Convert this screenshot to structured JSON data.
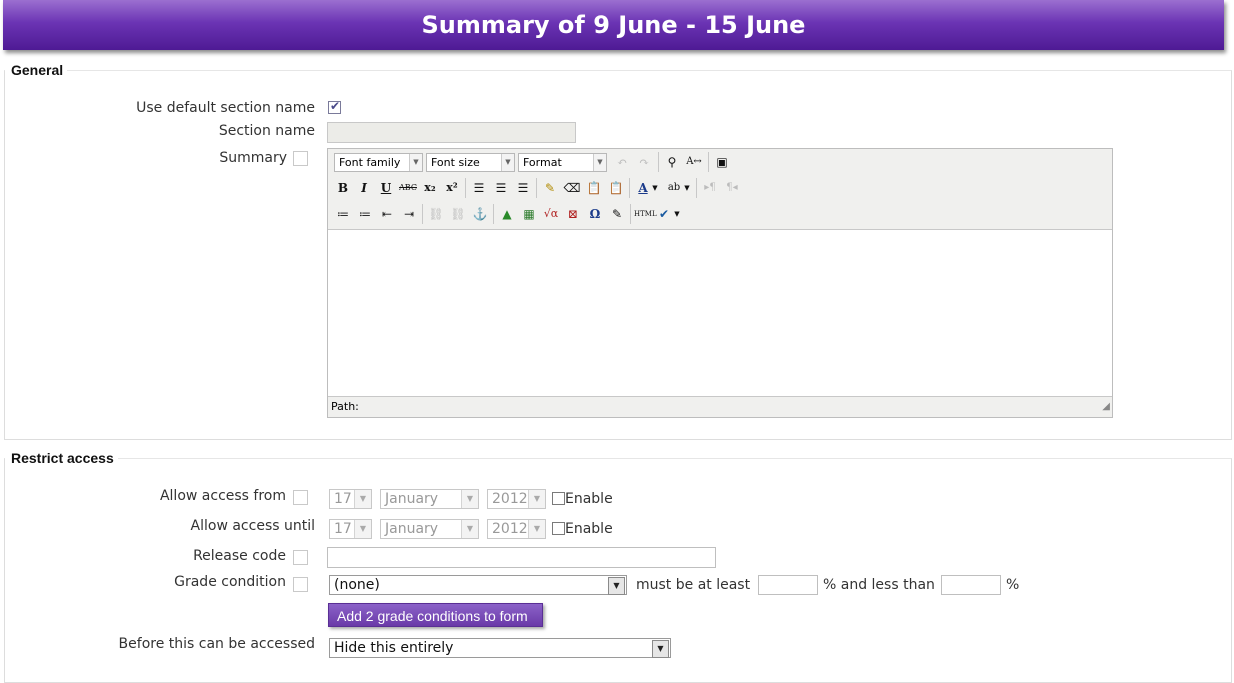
{
  "header": {
    "title": "Summary of 9 June - 15 June"
  },
  "general": {
    "legend": "General",
    "use_default_label": "Use default section name",
    "use_default_checked": true,
    "section_name_label": "Section name",
    "section_name_value": "",
    "summary_label": "Summary",
    "editor": {
      "font_family": "Font family",
      "font_size": "Font size",
      "format": "Format",
      "path_label": "Path:",
      "icons": {
        "bold": "B",
        "italic": "I",
        "underline": "U",
        "strike": "ABC",
        "subscript": "x₂",
        "superscript": "x²",
        "omega": "Ω",
        "html": "HTML"
      }
    }
  },
  "restrict": {
    "legend": "Restrict access",
    "from_label": "Allow access from",
    "until_label": "Allow access until",
    "from": {
      "day": "17",
      "month": "January",
      "year": "2012",
      "enable": "Enable"
    },
    "until": {
      "day": "17",
      "month": "January",
      "year": "2012",
      "enable": "Enable"
    },
    "release_code_label": "Release code",
    "release_code_value": "",
    "grade_condition_label": "Grade condition",
    "grade_condition_value": "(none)",
    "must_be_at_least": "must be at least",
    "pct_less_than": "% and less than",
    "pct": "%",
    "add_conditions_button": "Add 2 grade conditions to form",
    "before_accessed_label": "Before this can be accessed",
    "before_accessed_value": "Hide this entirely"
  }
}
